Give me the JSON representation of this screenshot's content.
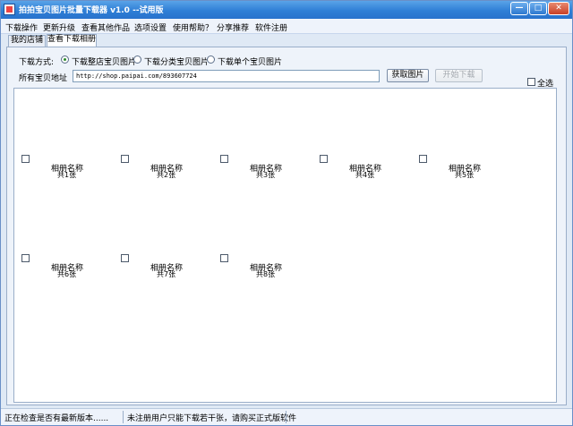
{
  "window": {
    "title": "拍拍宝贝图片批量下载器 v1.0 --试用版"
  },
  "window_controls": {
    "minimize": "—",
    "maximize": "□",
    "close": "✕"
  },
  "menu": [
    "下载操作",
    "更新升级",
    "查看其他作品",
    "选项设置",
    "使用帮助？",
    "分享推荐",
    "软件注册"
  ],
  "tabs": [
    {
      "label": "我的店铺",
      "active": false
    },
    {
      "label": "查看下载相册",
      "active": true
    }
  ],
  "download_mode": {
    "label": "下载方式:",
    "options": [
      {
        "label": "下载整店宝贝图片",
        "selected": true
      },
      {
        "label": "下载分类宝贝图片",
        "selected": false
      },
      {
        "label": "下载单个宝贝图片",
        "selected": false
      }
    ]
  },
  "url": {
    "label": "所有宝贝地址",
    "value": "http://shop.paipai.com/893607724"
  },
  "buttons": {
    "fetch": "获取图片",
    "start": "开始下载"
  },
  "select_all": {
    "label": "全选",
    "checked": false
  },
  "albums": [
    {
      "name": "相册名称",
      "count": "共1张"
    },
    {
      "name": "相册名称",
      "count": "共2张"
    },
    {
      "name": "相册名称",
      "count": "共3张"
    },
    {
      "name": "相册名称",
      "count": "共4张"
    },
    {
      "name": "相册名称",
      "count": "共5张"
    },
    {
      "name": "相册名称",
      "count": "共6张"
    },
    {
      "name": "相册名称",
      "count": "共7张"
    },
    {
      "name": "相册名称",
      "count": "共8张"
    }
  ],
  "status": {
    "left": "正在检查是否有最新版本......",
    "right": "未注册用户只能下载若干张，请购买正式版软件"
  }
}
